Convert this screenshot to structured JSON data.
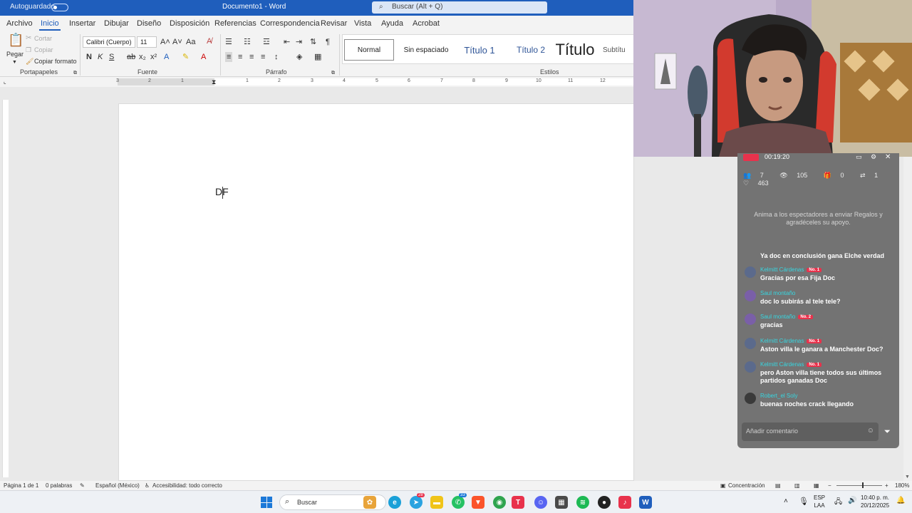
{
  "titlebar": {
    "autosave": "Autoguardado",
    "doc_title": "Documento1 - Word",
    "search_placeholder": "Buscar (Alt + Q)"
  },
  "ribbon_tabs": [
    "Archivo",
    "Inicio",
    "Insertar",
    "Dibujar",
    "Diseño",
    "Disposición",
    "Referencias",
    "Correspondencia",
    "Revisar",
    "Vista",
    "Ayuda",
    "Acrobat"
  ],
  "active_tab": "Inicio",
  "clipboard": {
    "paste": "Pegar",
    "cut": "Cortar",
    "copy": "Copiar",
    "format_painter": "Copiar formato",
    "group_label": "Portapapeles"
  },
  "font": {
    "family": "Calibri (Cuerpo)",
    "size": "11",
    "group_label": "Fuente",
    "bold": "N",
    "italic": "K",
    "underline": "S"
  },
  "paragraph": {
    "group_label": "Párrafo"
  },
  "styles": {
    "items": [
      "Normal",
      "Sin espaciado",
      "Título 1",
      "Título 2",
      "Título",
      "Subtítu"
    ],
    "group_label": "Estilos"
  },
  "ruler_numbers": [
    "3",
    "2",
    "1",
    "1",
    "2",
    "3",
    "4",
    "5",
    "6",
    "7",
    "8",
    "9",
    "10",
    "11",
    "12"
  ],
  "document": {
    "text": "DF"
  },
  "statusbar": {
    "page": "Página 1 de 1",
    "words": "0 palabras",
    "language": "Español (México)",
    "accessibility": "Accesibilidad: todo correcto",
    "focus": "Concentración",
    "zoom": "180%"
  },
  "taskbar": {
    "search": "Buscar",
    "lang_top": "ESP",
    "lang_bottom": "LAA",
    "time": "10:40 p. m.",
    "date": "20/12/2025",
    "badge_telegram": "28",
    "badge_whatsapp": "33"
  },
  "live": {
    "timer": "00:19:20",
    "stats": {
      "members": "7",
      "viewers": "105",
      "gifts": "0",
      "shares": "1",
      "likes": "463"
    },
    "hint": "Anima a los espectadores a enviar Regalos y agradéceles su apoyo.",
    "comments": [
      {
        "name": "",
        "badge": "",
        "msg": "Ya doc en conclusión gana Elche verdad"
      },
      {
        "name": "Kelmitt Cárdenas",
        "badge": "No. 1",
        "msg": "Gracias por esa Fija Doc"
      },
      {
        "name": "Saul montaño",
        "badge": "",
        "msg": "doc lo subirás al tele tele?"
      },
      {
        "name": "Saul montaño",
        "badge": "No. 2",
        "msg": "gracias"
      },
      {
        "name": "Kelmitt Cárdenas",
        "badge": "No. 1",
        "msg": "Aston villa le ganara a Manchester Doc?"
      },
      {
        "name": "Kelmitt Cárdenas",
        "badge": "No. 1",
        "msg": "pero Aston villa tiene todos sus últimos partidos ganadas Doc"
      },
      {
        "name": "Robert_el Soly",
        "badge": "",
        "msg": "buenas noches crack llegando"
      }
    ],
    "comment_placeholder": "Añadir comentario"
  }
}
